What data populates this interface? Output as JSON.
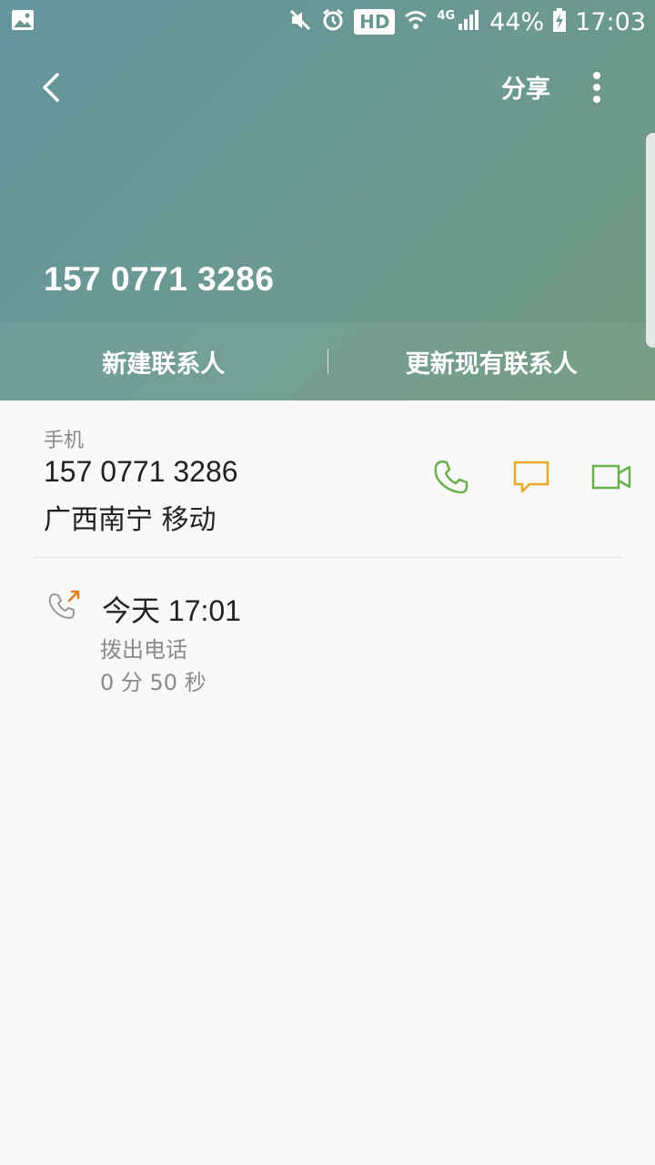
{
  "statusbar": {
    "battery": "44%",
    "time": "17:03",
    "hd": "HD",
    "network": "4G",
    "icons": [
      "gallery-icon",
      "mute-icon",
      "alarm-icon",
      "wifi-icon",
      "signal-icon",
      "battery-charging-icon"
    ]
  },
  "header": {
    "share_label": "分享",
    "phone_number": "157 0771 3286",
    "actions": {
      "new_contact": "新建联系人",
      "update_contact": "更新现有联系人"
    }
  },
  "detail": {
    "label": "手机",
    "number": "157 0771 3286",
    "location": "广西南宁 移动",
    "quick_actions": [
      "phone-icon",
      "message-icon",
      "video-call-icon"
    ]
  },
  "call_log": {
    "time": "今天 17:01",
    "type": "拨出电话",
    "duration": "0 分 50 秒"
  },
  "colors": {
    "call_green": "#6ab04c",
    "message_orange": "#e9a825",
    "outgoing_orange": "#e07d1b"
  }
}
